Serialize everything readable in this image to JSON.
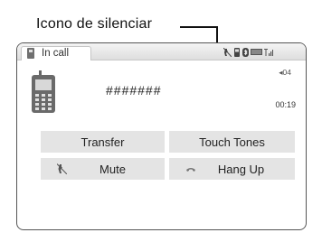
{
  "callout": {
    "label": "Icono de silenciar"
  },
  "statusbar": {
    "tab_label": "In call",
    "icons": [
      "mute-icon",
      "phone-icon",
      "bluetooth-icon",
      "battery-icon",
      "signal-icon"
    ]
  },
  "call": {
    "number": "#######",
    "volume": "◂04",
    "timer": "00:19"
  },
  "buttons": {
    "transfer": "Transfer",
    "touch_tones": "Touch Tones",
    "mute": "Mute",
    "hang_up": "Hang Up"
  }
}
